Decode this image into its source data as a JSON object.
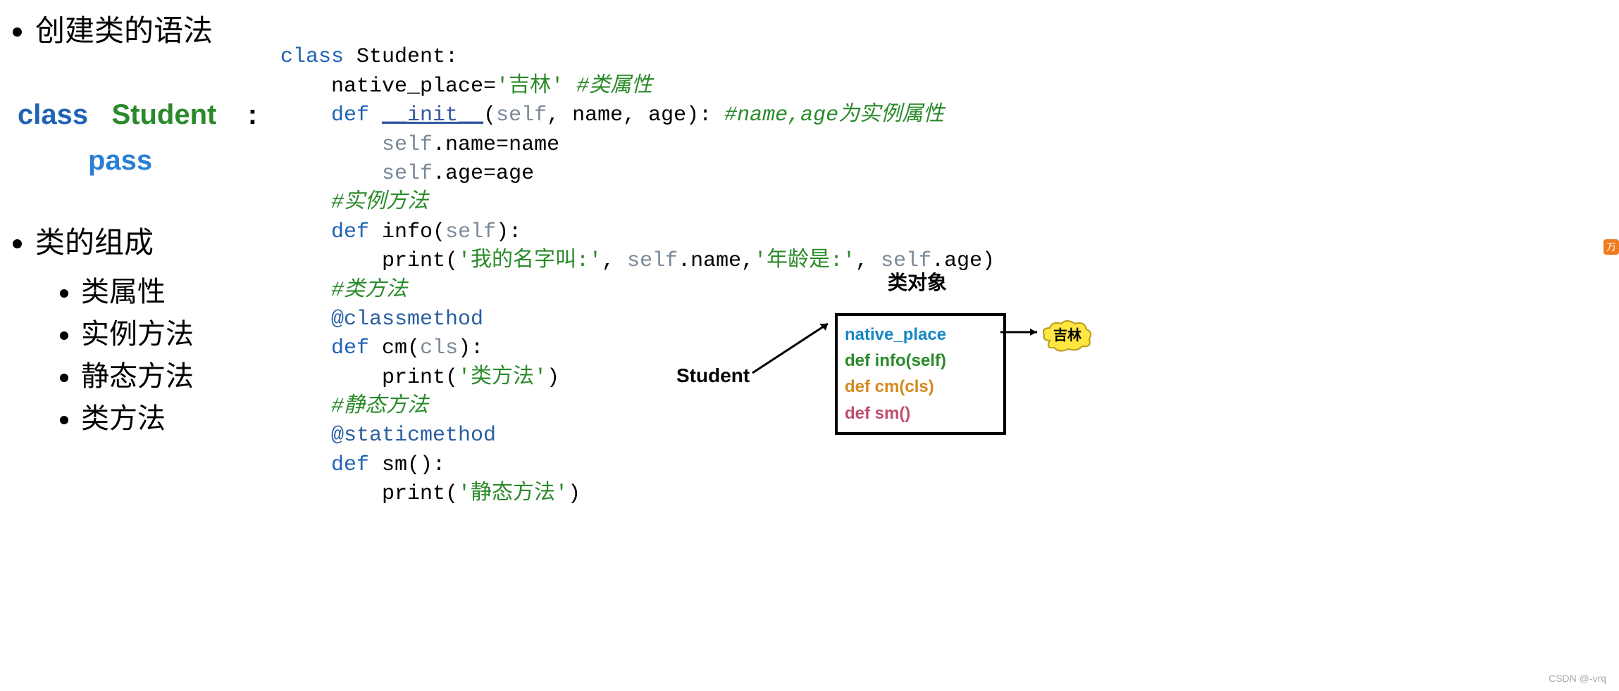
{
  "left": {
    "heading1": "创建类的语法",
    "syntax": {
      "kw": "class",
      "name": "Student",
      "colon": ":",
      "pass": "pass"
    },
    "heading2": "类的组成",
    "items": [
      "类属性",
      "实例方法",
      "静态方法",
      "类方法"
    ]
  },
  "code": {
    "l1_kw": "class",
    "l1_name": " Student:",
    "l2_pre": "    native_place=",
    "l2_str": "'吉林'",
    "l2_cmt": " #类属性",
    "l3_kw": "    def ",
    "l3_name": "__init__",
    "l3_sig": "(",
    "l3_self": "self",
    "l3_rest": ", name, age): ",
    "l3_cmt": "#name,age为实例属性",
    "l4": "        ",
    "l4_self": "self",
    "l4_rest": ".name=name",
    "l5": "        ",
    "l5_self": "self",
    "l5_rest": ".age=age",
    "l6_cmt": "    #实例方法",
    "l7_kw": "    def ",
    "l7_name": "info",
    "l7_sig": "(",
    "l7_self": "self",
    "l7_end": "):",
    "l8": "        print(",
    "l8_s1": "'我的名字叫:'",
    "l8_m": ", ",
    "l8_self": "self",
    "l8_m2": ".name,",
    "l8_s2": "'年龄是:'",
    "l8_m3": ", ",
    "l8_self2": "self",
    "l8_m4": ".age)",
    "l9_cmt": "    #类方法",
    "l10_deco": "    @classmethod",
    "l11_kw": "    def ",
    "l11_name": "cm",
    "l11_sig": "(",
    "l11_cls": "cls",
    "l11_end": "):",
    "l12": "        print(",
    "l12_s": "'类方法'",
    "l12_e": ")",
    "l13_cmt": "    #静态方法",
    "l14_deco": "    @staticmethod",
    "l15_kw": "    def ",
    "l15_name": "sm",
    "l15_sig": "():",
    "l16": "        print(",
    "l16_s": "'静态方法'",
    "l16_e": ")"
  },
  "diagram": {
    "title": "类对象",
    "student": "Student",
    "box": {
      "np": "native_place",
      "info": "def info(self)",
      "cm": "def cm(cls)",
      "sm": "def sm()"
    },
    "cloud": "吉林"
  },
  "side_icon": "万",
  "watermark": "CSDN @-vrq"
}
